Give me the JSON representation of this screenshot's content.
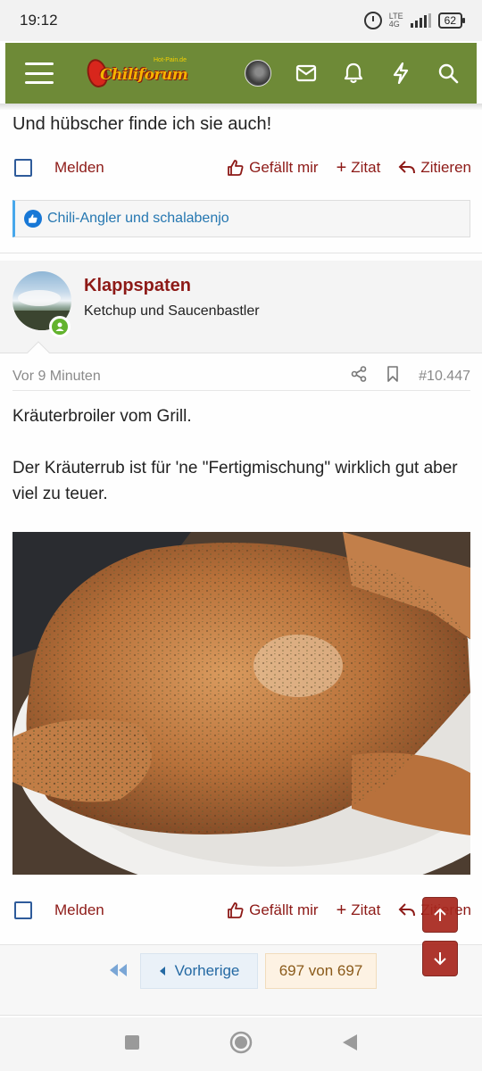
{
  "status_bar": {
    "time": "19:12",
    "network": "LTE",
    "network_sub": "4G",
    "battery": "62"
  },
  "header": {
    "logo_text": "Chiliforum",
    "logo_subtext": "Hot-Pain.de"
  },
  "prev_post": {
    "last_line": "Und hübscher finde ich sie auch!",
    "report_label": "Melden",
    "like_label": "Gefällt mir",
    "quote_label": "Zitat",
    "reply_label": "Zitieren",
    "likes_text": "Chili-Angler und schalabenjo"
  },
  "post": {
    "author": "Klappspaten",
    "user_title": "Ketchup und Saucenbastler",
    "time": "Vor 9 Minuten",
    "post_number": "#10.447",
    "body_lines": [
      "Kräuterbroiler vom Grill.",
      "Der Kräuterrub ist für 'ne \"Fertigmischung\" wirklich gut aber viel zu teuer."
    ],
    "report_label": "Melden",
    "like_label": "Gefällt mir",
    "quote_label": "Zitat",
    "reply_label": "Zitieren"
  },
  "pagination": {
    "prev_label": "Vorherige",
    "current": "697 von 697"
  },
  "colors": {
    "header": "#6e8a37",
    "accent_red": "#8d1a17",
    "link_blue": "#2577b1"
  }
}
